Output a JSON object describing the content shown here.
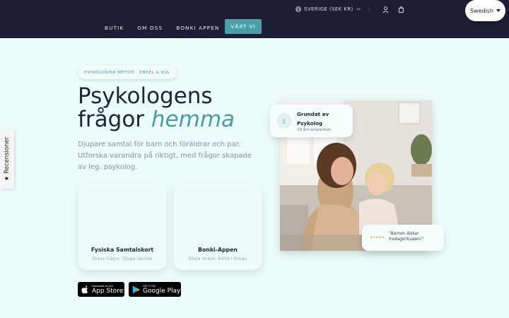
{
  "header": {
    "locale": "SVERIGE (SEK KR)",
    "nav": [
      "BUTIK",
      "OM OSS",
      "BONKI APPEN"
    ],
    "cta": "VÅRT VI",
    "language": "Swedish"
  },
  "side_tab": {
    "label": "★ Recensioner"
  },
  "hero": {
    "badge": "PSYKOLOGISK METOD · ENKEL & KUL",
    "title_line1": "Psykologens",
    "title_line2_plain": "frågor ",
    "title_line2_accent": "hemma",
    "description": "Djupare samtal för barn och föräldrar och par. Utforska varandra på riktigt, med frågor skapade av leg. psykolog."
  },
  "cards": [
    {
      "title": "Fysiska Samtalskort",
      "subtitle": "Enkla frågor. Djupa samtal"
    },
    {
      "title": "Bonki-Appen",
      "subtitle": "Börja direkt. Alltid i fickan"
    }
  ],
  "stores": {
    "apple": {
      "small": "Download on the",
      "big": "App Store"
    },
    "google": {
      "small": "GET IT ON",
      "big": "Google Play"
    }
  },
  "float_founded": {
    "line1": "Grundat av",
    "line2": "Psykolog",
    "line3": "29 års erfarenhet"
  },
  "float_review": {
    "stars": "★★★★★",
    "quote": "\"Barnen älskar fredagsritualen!\""
  },
  "colors": {
    "header_bg": "#1d1e35",
    "accent": "#4ba0a8",
    "page_bg": "#ebfcfb"
  }
}
